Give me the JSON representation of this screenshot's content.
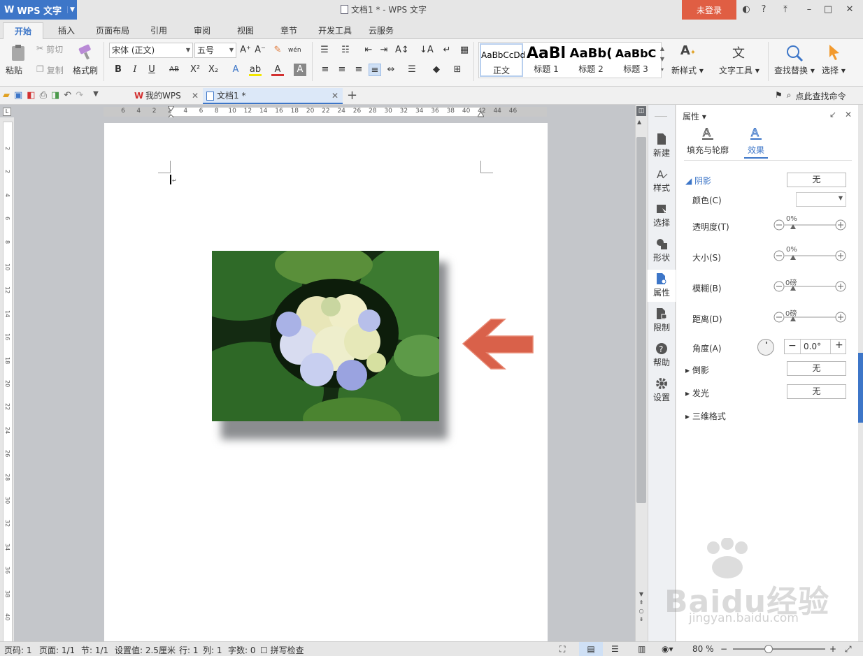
{
  "app": {
    "logo": "WPS 文字",
    "title": "文档1 * - WPS 文字",
    "login": "未登录"
  },
  "menu": [
    "开始",
    "插入",
    "页面布局",
    "引用",
    "审阅",
    "视图",
    "章节",
    "开发工具",
    "云服务"
  ],
  "ribbon": {
    "paste": "粘贴",
    "cut": "剪切",
    "copy": "复制",
    "format_painter": "格式刷",
    "font_name": "宋体 (正文)",
    "font_size": "五号",
    "styles": [
      {
        "sample": "AaBbCcDd",
        "name": "正文"
      },
      {
        "sample": "AaBl",
        "name": "标题 1"
      },
      {
        "sample": "AaBb(",
        "name": "标题 2"
      },
      {
        "sample": "AaBbC",
        "name": "标题 3"
      }
    ],
    "new_style": "新样式",
    "text_tools": "文字工具",
    "find_replace": "查找替换",
    "select": "选择"
  },
  "tabs": {
    "mywps": "我的WPS",
    "doc": "文档1 *",
    "search_cmd": "点此查找命令"
  },
  "ruler": {
    "h_ticks": [
      "6",
      "4",
      "2",
      "2",
      "4",
      "6",
      "8",
      "10",
      "12",
      "14",
      "16",
      "18",
      "20",
      "22",
      "24",
      "26",
      "28",
      "30",
      "32",
      "34",
      "36",
      "38",
      "40",
      "42",
      "44",
      "46"
    ],
    "v_ticks": [
      "2",
      "2",
      "4",
      "6",
      "8",
      "10",
      "12",
      "14",
      "16",
      "18",
      "20",
      "22",
      "24",
      "26",
      "28",
      "30",
      "32",
      "34",
      "36",
      "38",
      "40"
    ]
  },
  "sidebar": [
    {
      "label": "新建",
      "icon": "new-doc-icon"
    },
    {
      "label": "样式",
      "icon": "style-icon"
    },
    {
      "label": "选择",
      "icon": "select-icon"
    },
    {
      "label": "形状",
      "icon": "shape-icon"
    },
    {
      "label": "属性",
      "icon": "property-icon"
    },
    {
      "label": "限制",
      "icon": "restrict-icon"
    },
    {
      "label": "帮助",
      "icon": "help-icon"
    },
    {
      "label": "设置",
      "icon": "gear-icon"
    }
  ],
  "pane": {
    "title": "属性",
    "tab_fill": "填充与轮廓",
    "tab_effect": "效果",
    "shadow": "阴影",
    "shadow_value": "无",
    "color": "颜色(C)",
    "transparency": "透明度(T)",
    "transparency_value": "0%",
    "size": "大小(S)",
    "size_value": "0%",
    "blur": "模糊(B)",
    "blur_value": "0磅",
    "distance": "距离(D)",
    "distance_value": "0磅",
    "angle": "角度(A)",
    "angle_value": "0.0°",
    "reflection": "倒影",
    "reflection_value": "无",
    "glow": "发光",
    "glow_value": "无",
    "threed": "三维格式"
  },
  "status": {
    "page_no": "页码: 1",
    "pages": "页面: 1/1",
    "section": "节: 1/1",
    "setting": "设置值: 2.5厘米",
    "row": "行: 1",
    "col": "列: 1",
    "words": "字数: 0",
    "spell": "拼写检查",
    "zoom": "80 %"
  },
  "watermark": {
    "brand": "Baidu经验",
    "url": "jingyan.baidu.com"
  },
  "colors": {
    "accent": "#3d76c8",
    "login": "#e05e43",
    "arrow": "#d9614a"
  }
}
